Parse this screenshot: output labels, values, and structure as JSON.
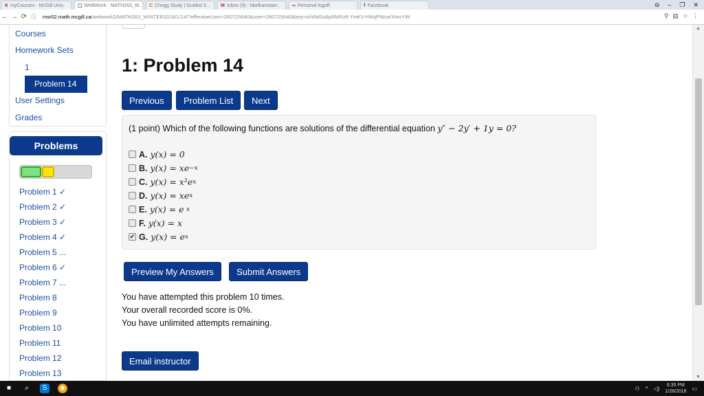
{
  "browser": {
    "tabs": [
      {
        "icon": "K",
        "label": "myCourses - McGill Univ..",
        "color": "#b22222"
      },
      {
        "icon": "▢",
        "label": "WeBWorK : MATH263_W..",
        "color": "#333333",
        "active": true
      },
      {
        "icon": "C",
        "label": "Chegg Study | Guided S..",
        "color": "#e06a00"
      },
      {
        "icon": "M",
        "label": "Inbox (9) - bbelkamsian..",
        "color": "#c5221f"
      },
      {
        "icon": "∞",
        "label": "Personal logoff",
        "color": "#c5221f"
      },
      {
        "icon": "f",
        "label": "Facebook",
        "color": "#3b5998"
      }
    ],
    "url_host": "msr02.math.mcgill.ca",
    "url_path": "/webwork2/MATH263_WINTER2018/1/14/?effectiveUser=260725640&user=260725640&key=ichRdSo8yRMRzll-YmKV-hWqPWce/XmvYW"
  },
  "sidebar": {
    "menu": [
      "Courses",
      "Homework Sets",
      "1"
    ],
    "active_item": "Problem 14",
    "menu_bottom": [
      "User Settings",
      "Grades"
    ],
    "problems_header": "Problems",
    "problem_list": [
      "Problem 1 ✓",
      "Problem 2 ✓",
      "Problem 3 ✓",
      "Problem 4 ✓",
      "Problem 5 ...",
      "Problem 6 ✓",
      "Problem 7 ...",
      "Problem 8",
      "Problem 9",
      "Problem 10",
      "Problem 11",
      "Problem 12",
      "Problem 13"
    ]
  },
  "main": {
    "title": "1: Problem 14",
    "nav": {
      "previous": "Previous",
      "list": "Problem List",
      "next": "Next"
    },
    "question_prefix": "(1 point) Which of the following functions are solutions of the differential equation",
    "equation": "y″ − 2y′ + 1y = 0?",
    "options": [
      {
        "letter": "A.",
        "expr": "y(x) = 0",
        "checked": false
      },
      {
        "letter": "B.",
        "expr": "y(x) = xe",
        "sup": "−x",
        "checked": false
      },
      {
        "letter": "C.",
        "expr": "y(x) = x²e",
        "sup": "x",
        "checked": false
      },
      {
        "letter": "D.",
        "expr": "y(x) = xe",
        "sup": "x",
        "checked": false
      },
      {
        "letter": "E.",
        "expr": "y(x) = e",
        "sup": "x",
        "checked": false
      },
      {
        "letter": "F.",
        "expr": "y(x) = x",
        "checked": false
      },
      {
        "letter": "G.",
        "expr": "y(x) = e",
        "sup": "x",
        "checked": true
      }
    ],
    "preview_label": "Preview My Answers",
    "submit_label": "Submit Answers",
    "status": [
      "You have attempted this problem 10 times.",
      "Your overall recorded score is 0%.",
      "You have unlimited attempts remaining."
    ],
    "email_label": "Email instructor"
  },
  "taskbar": {
    "time": "6:35 PM",
    "date": "1/28/2018"
  },
  "colors": {
    "accent": "#0b3a8c",
    "link": "#1a4fa0"
  }
}
